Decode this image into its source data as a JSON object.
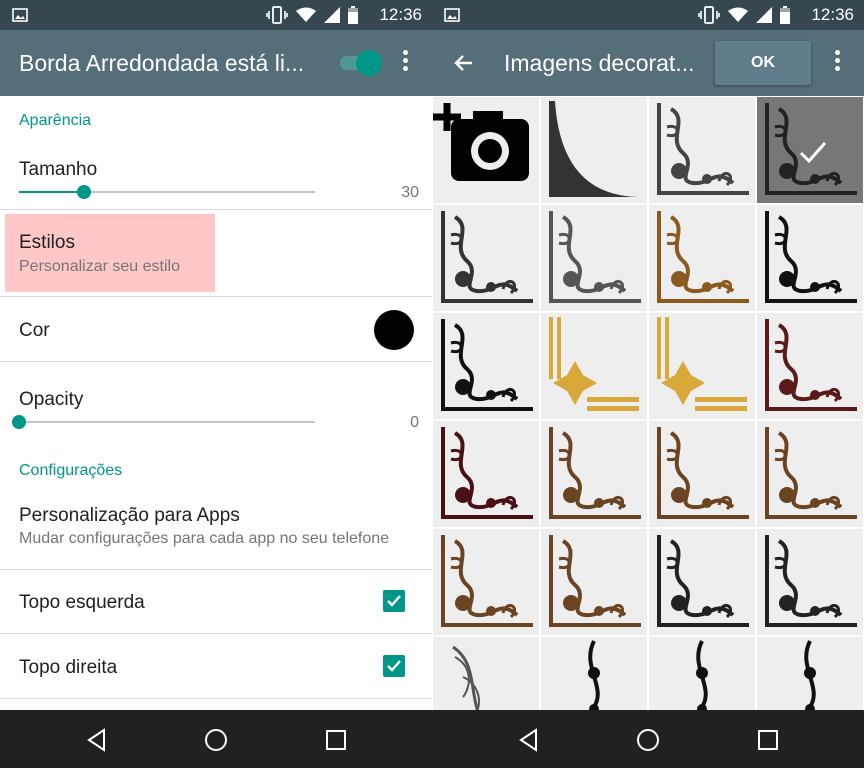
{
  "status": {
    "time": "12:36"
  },
  "left": {
    "app_title": "Borda Arredondada está li...",
    "toggle_on": true,
    "sections": {
      "appearance": "Aparência",
      "settings": "Configurações"
    },
    "size": {
      "title": "Tamanho",
      "value": "30",
      "fraction": 0.22
    },
    "styles": {
      "title": "Estilos",
      "subtitle": "Personalizar seu estilo"
    },
    "color": {
      "title": "Cor",
      "swatch": "#000000"
    },
    "opacity": {
      "title": "Opacity",
      "value": "0",
      "fraction": 0.0
    },
    "per_app": {
      "title": "Personalização para Apps",
      "subtitle": "Mudar configurações para cada app no seu telefone"
    },
    "top_left": {
      "title": "Topo esquerda",
      "checked": true
    },
    "top_right": {
      "title": "Topo direita",
      "checked": true
    }
  },
  "right": {
    "title": "Imagens decorat...",
    "ok_label": "OK",
    "tiles": [
      {
        "icon": "add-photo-icon",
        "color": "#000000"
      },
      {
        "icon": "rounded-corner-icon",
        "color": "#333333"
      },
      {
        "icon": "swirl-corner-icon",
        "color": "#444444"
      },
      {
        "icon": "ornament-corner-icon",
        "color": "#222222",
        "selected": true
      },
      {
        "icon": "swirl-corner-icon",
        "color": "#333333"
      },
      {
        "icon": "vine-corner-icon",
        "color": "#555555"
      },
      {
        "icon": "art-deco-corner-icon",
        "color": "#8a5a1e"
      },
      {
        "icon": "leaf-corner-icon",
        "color": "#111111"
      },
      {
        "icon": "flourish-corner-icon",
        "color": "#111111"
      },
      {
        "icon": "snowflake-corner-icon",
        "color": "#d9a83a"
      },
      {
        "icon": "snowflake-corner-icon",
        "color": "#d9a83a"
      },
      {
        "icon": "baroque-corner-icon",
        "color": "#5a1a1a"
      },
      {
        "icon": "baroque-corner-icon",
        "color": "#4a1018"
      },
      {
        "icon": "scroll-corner-icon",
        "color": "#6b4423"
      },
      {
        "icon": "scroll-corner-icon",
        "color": "#6b4423"
      },
      {
        "icon": "scroll-corner-icon",
        "color": "#6b4423"
      },
      {
        "icon": "scroll-corner-icon",
        "color": "#6b4423"
      },
      {
        "icon": "scroll-corner-icon",
        "color": "#6b4423"
      },
      {
        "icon": "floral-corner-icon",
        "color": "#222222"
      },
      {
        "icon": "floral-corner-icon",
        "color": "#222222"
      },
      {
        "icon": "feather-icon",
        "color": "#555555"
      },
      {
        "icon": "vine-border-icon",
        "color": "#111111"
      },
      {
        "icon": "ornament-border-icon",
        "color": "#111111"
      },
      {
        "icon": "vine-border-icon",
        "color": "#111111"
      }
    ]
  },
  "colors": {
    "statusbar": "#37474f",
    "appbar": "#546e7a",
    "accent": "#009688",
    "highlight": "#ffc8c8"
  }
}
